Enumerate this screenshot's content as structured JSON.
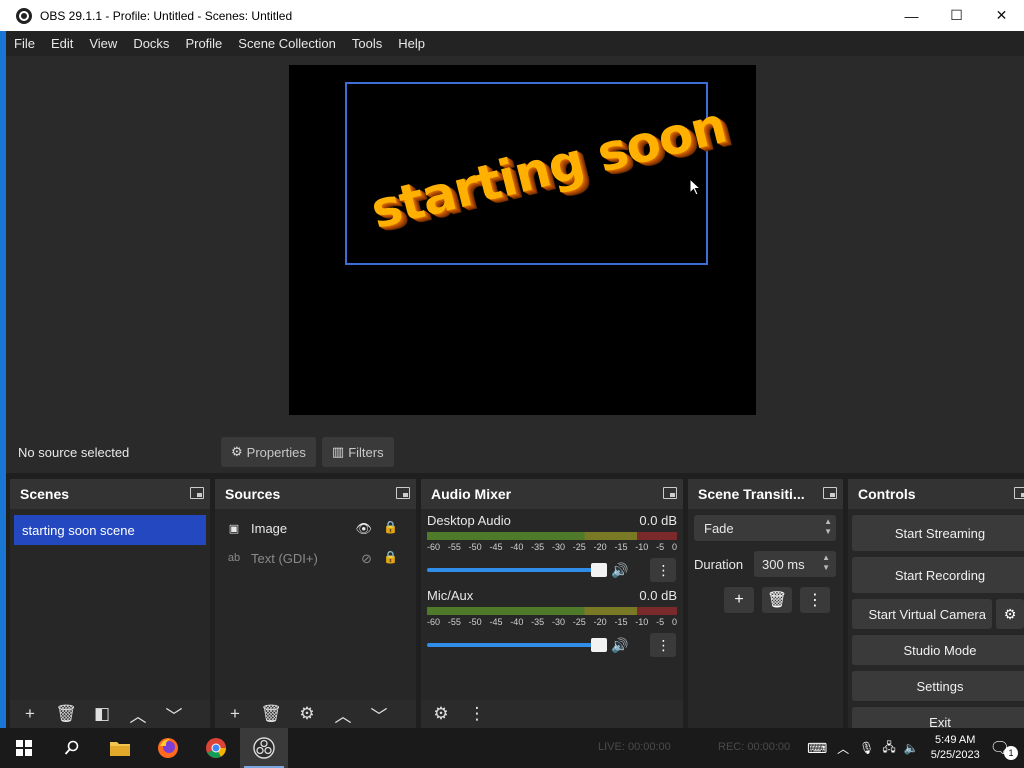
{
  "window": {
    "title": "OBS 29.1.1 - Profile: Untitled - Scenes: Untitled",
    "controls": {
      "minimize": "—",
      "maximize": "☐",
      "close": "✕"
    }
  },
  "menubar": [
    "File",
    "Edit",
    "View",
    "Docks",
    "Profile",
    "Scene Collection",
    "Tools",
    "Help"
  ],
  "preview": {
    "text": "starting soon"
  },
  "source_toolbar": {
    "status": "No source selected",
    "properties": "Properties",
    "filters": "Filters"
  },
  "scenes": {
    "title": "Scenes",
    "items": [
      "starting soon scene"
    ]
  },
  "sources": {
    "title": "Sources",
    "items": [
      {
        "type_icon": "image-icon",
        "label": "Image"
      },
      {
        "type_icon": "text-icon",
        "label": "Text (GDI+)"
      }
    ]
  },
  "audio_mixer": {
    "title": "Audio Mixer",
    "channels": [
      {
        "name": "Desktop Audio",
        "level": "0.0 dB"
      },
      {
        "name": "Mic/Aux",
        "level": "0.0 dB"
      }
    ],
    "ticks": [
      "-60",
      "-55",
      "-50",
      "-45",
      "-40",
      "-35",
      "-30",
      "-25",
      "-20",
      "-15",
      "-10",
      "-5",
      "0"
    ]
  },
  "transitions": {
    "title": "Scene Transiti...",
    "selected": "Fade",
    "duration_label": "Duration",
    "duration_value": "300 ms"
  },
  "controls": {
    "title": "Controls",
    "start_streaming": "Start Streaming",
    "start_recording": "Start Recording",
    "start_virtual_camera": "Start Virtual Camera",
    "studio_mode": "Studio Mode",
    "settings": "Settings",
    "exit": "Exit"
  },
  "statusbar": {
    "live": "LIVE: 00:00:00",
    "rec": "REC: 00:00:00"
  },
  "taskbar": {
    "time": "5:49 AM",
    "date": "5/25/2023",
    "notification_count": "1"
  },
  "colors": {
    "accent": "#1976d2",
    "scene_selected": "#2348c0",
    "selection_box": "#3c6ed6",
    "text_gold": "#ffb000"
  }
}
